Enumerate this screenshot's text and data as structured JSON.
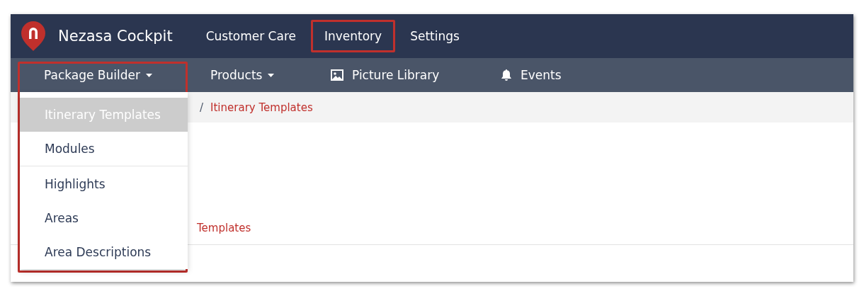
{
  "app": {
    "name": "Nezasa Cockpit"
  },
  "main_nav": [
    {
      "label": "Customer Care",
      "annotated": false
    },
    {
      "label": "Inventory",
      "annotated": true
    },
    {
      "label": "Settings",
      "annotated": false
    }
  ],
  "sub_nav": [
    {
      "label": "Package Builder",
      "kind": "dropdown"
    },
    {
      "label": "Products",
      "kind": "dropdown"
    },
    {
      "label": "Picture Library",
      "kind": "picture"
    },
    {
      "label": "Events",
      "kind": "bell"
    }
  ],
  "dropdown_menu": {
    "annotated": true,
    "groups": [
      [
        {
          "label": "Itinerary Templates",
          "selected": true
        },
        {
          "label": "Modules",
          "selected": false
        }
      ],
      [
        {
          "label": "Highlights",
          "selected": false
        },
        {
          "label": "Areas",
          "selected": false
        },
        {
          "label": "Area Descriptions",
          "selected": false
        }
      ]
    ]
  },
  "breadcrumb": [
    {
      "label": "/",
      "kind": "separator"
    },
    {
      "label": "Itinerary Templates",
      "kind": "current"
    }
  ],
  "content": {
    "link": "Templates"
  }
}
